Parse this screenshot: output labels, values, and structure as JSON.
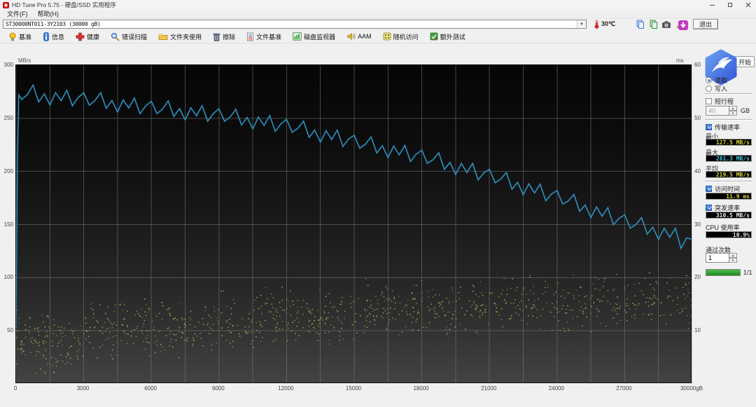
{
  "window": {
    "title": "HD Tune Pro 5.75 - 硬盘/SSD 实用程序"
  },
  "menu_bar": {
    "items": [
      "文件(F)",
      "帮助(H)"
    ]
  },
  "drive_bar": {
    "drive": "ST30000NT011-3Y2103 (30000 gB)",
    "temperature": "30℃",
    "exit": "退出"
  },
  "toolbar": {
    "items": [
      "基准",
      "信息",
      "健康",
      "错误扫描",
      "文件夹使用",
      "擦除",
      "文件基准",
      "磁盘监视器",
      "AAM",
      "随机访问",
      "额外测试"
    ]
  },
  "chart_data": {
    "type": "line+scatter",
    "x_axis": {
      "min": 0,
      "max": 30000,
      "grid_interval": 1500,
      "tick_labels": [
        "0",
        "3000",
        "6000",
        "9000",
        "12000",
        "15000",
        "18000",
        "21000",
        "24000",
        "27000",
        "30000gB"
      ],
      "tick_values": [
        0,
        3000,
        6000,
        9000,
        12000,
        15000,
        18000,
        21000,
        24000,
        27000,
        30000
      ]
    },
    "y_left": {
      "label": "MB/s",
      "min": 0,
      "max": 300,
      "tick_interval": 50,
      "tick_labels": [
        "300",
        "250",
        "200",
        "150",
        "100",
        "50"
      ],
      "tick_values": [
        300,
        250,
        200,
        150,
        100,
        50
      ]
    },
    "y_right": {
      "label": "ms",
      "min": 0,
      "max": 60,
      "tick_interval": 10,
      "tick_labels": [
        "60",
        "50",
        "40",
        "30",
        "20",
        "10"
      ],
      "tick_values": [
        60,
        50,
        40,
        30,
        20,
        10
      ]
    },
    "grid_color": "#7a7a7a",
    "series": [
      {
        "name": "transfer-rate",
        "type": "line",
        "axis": "left",
        "color": "#3a9fd2",
        "points": [
          [
            0,
            52
          ],
          [
            60,
            215
          ],
          [
            120,
            272
          ],
          [
            250,
            267.6
          ],
          [
            500,
            272.2
          ],
          [
            750,
            281.3
          ],
          [
            1000,
            265.3
          ],
          [
            1250,
            272.9
          ],
          [
            1500,
            262.5
          ],
          [
            1750,
            274.1
          ],
          [
            2000,
            266.7
          ],
          [
            2250,
            276.3
          ],
          [
            2500,
            261.8
          ],
          [
            2750,
            269.4
          ],
          [
            3000,
            274.0
          ],
          [
            3250,
            262.3
          ],
          [
            3500,
            266.7
          ],
          [
            3750,
            274.0
          ],
          [
            4000,
            259.3
          ],
          [
            4250,
            266.7
          ],
          [
            4500,
            256.0
          ],
          [
            4750,
            267.3
          ],
          [
            5000,
            259.7
          ],
          [
            5250,
            269.0
          ],
          [
            5500,
            254.3
          ],
          [
            5750,
            261.7
          ],
          [
            6000,
            266.0
          ],
          [
            6250,
            254.4
          ],
          [
            6500,
            258.8
          ],
          [
            6750,
            266.3
          ],
          [
            7000,
            251.7
          ],
          [
            7250,
            259.1
          ],
          [
            7500,
            248.5
          ],
          [
            7750,
            259.9
          ],
          [
            8000,
            252.3
          ],
          [
            8250,
            261.8
          ],
          [
            8500,
            247.2
          ],
          [
            8750,
            254.6
          ],
          [
            9000,
            259.0
          ],
          [
            9250,
            247.2
          ],
          [
            9500,
            251.3
          ],
          [
            9750,
            258.5
          ],
          [
            10000,
            243.7
          ],
          [
            10250,
            250.8
          ],
          [
            10500,
            240.0
          ],
          [
            10750,
            251.2
          ],
          [
            11000,
            243.3
          ],
          [
            11250,
            252.5
          ],
          [
            11500,
            237.7
          ],
          [
            11750,
            244.8
          ],
          [
            12000,
            249.0
          ],
          [
            12250,
            236.8
          ],
          [
            12500,
            240.5
          ],
          [
            12750,
            247.3
          ],
          [
            13000,
            232.0
          ],
          [
            13250,
            238.8
          ],
          [
            13500,
            227.5
          ],
          [
            13750,
            238.3
          ],
          [
            14000,
            230.0
          ],
          [
            14250,
            238.8
          ],
          [
            14500,
            223.5
          ],
          [
            14750,
            230.3
          ],
          [
            15000,
            234.0
          ],
          [
            15250,
            221.8
          ],
          [
            15500,
            225.7
          ],
          [
            15750,
            232.5
          ],
          [
            16000,
            217.3
          ],
          [
            16250,
            224.2
          ],
          [
            16500,
            213.0
          ],
          [
            16750,
            223.8
          ],
          [
            17000,
            215.7
          ],
          [
            17250,
            224.5
          ],
          [
            17500,
            209.3
          ],
          [
            17750,
            216.2
          ],
          [
            18000,
            220.0
          ],
          [
            18250,
            207.5
          ],
          [
            18500,
            211.0
          ],
          [
            18750,
            217.5
          ],
          [
            19000,
            202.0
          ],
          [
            19250,
            208.5
          ],
          [
            19500,
            197.0
          ],
          [
            19750,
            207.5
          ],
          [
            20000,
            199.0
          ],
          [
            20250,
            207.5
          ],
          [
            20500,
            192.0
          ],
          [
            20750,
            198.5
          ],
          [
            21000,
            202.0
          ],
          [
            21250,
            189.3
          ],
          [
            21500,
            192.7
          ],
          [
            21750,
            199.0
          ],
          [
            22000,
            183.3
          ],
          [
            22250,
            189.7
          ],
          [
            22500,
            178.0
          ],
          [
            22750,
            188.3
          ],
          [
            23000,
            179.7
          ],
          [
            23250,
            188.0
          ],
          [
            23500,
            172.3
          ],
          [
            23750,
            178.7
          ],
          [
            24000,
            182.0
          ],
          [
            24250,
            169.1
          ],
          [
            24500,
            172.2
          ],
          [
            24750,
            178.3
          ],
          [
            25000,
            162.3
          ],
          [
            25250,
            168.4
          ],
          [
            25500,
            156.5
          ],
          [
            25750,
            166.6
          ],
          [
            26000,
            157.7
          ],
          [
            26250,
            165.8
          ],
          [
            26500,
            149.8
          ],
          [
            26750,
            155.9
          ],
          [
            27000,
            159.0
          ],
          [
            27250,
            146.5
          ],
          [
            27500,
            150.0
          ],
          [
            27750,
            156.5
          ],
          [
            28000,
            141.0
          ],
          [
            28250,
            147.5
          ],
          [
            28500,
            136.0
          ],
          [
            28750,
            146.5
          ],
          [
            29000,
            138.0
          ],
          [
            29250,
            146.5
          ],
          [
            29500,
            127.5
          ],
          [
            29750,
            137.5
          ],
          [
            30000,
            136.0
          ]
        ]
      },
      {
        "name": "access-time",
        "type": "scatter",
        "axis": "right",
        "color": "#b7ae55",
        "seed": 20240613,
        "stats": {
          "avg_ms": 11.9
        },
        "bands": [
          {
            "gb": [
              0,
              3000
            ],
            "ms": [
              1.5,
              14.5
            ],
            "count": 130
          },
          {
            "gb": [
              3000,
              9000
            ],
            "ms": [
              4,
              16.5
            ],
            "count": 210
          },
          {
            "gb": [
              9000,
              15000
            ],
            "ms": [
              6.5,
              18.5
            ],
            "count": 210
          },
          {
            "gb": [
              15000,
              21000
            ],
            "ms": [
              8.5,
              20
            ],
            "count": 210
          },
          {
            "gb": [
              21000,
              30000
            ],
            "ms": [
              9.5,
              21
            ],
            "count": 270
          }
        ]
      }
    ]
  },
  "panel": {
    "start": "开始",
    "mode": {
      "read": "读取",
      "write": "写入",
      "selected": "read"
    },
    "short_stroke": {
      "label": "短行程",
      "checked": false,
      "value": "40",
      "unit": "GB"
    },
    "transfer": {
      "label": "传输速率",
      "checked": true,
      "min_label": "最小",
      "min": "127.5 MB/s",
      "max_label": "最大",
      "max": "281.3 MB/s",
      "avg_label": "平均",
      "avg": "219.5 MB/s"
    },
    "access": {
      "label": "访问时间",
      "checked": true,
      "value": "11.9 ms"
    },
    "burst": {
      "label": "突发速率",
      "checked": true,
      "value": "310.5 MB/s"
    },
    "cpu": {
      "label": "CPU 使用率",
      "value": "10.9%"
    },
    "passes": {
      "label": "通过次数",
      "value": "1",
      "progress": 1.0,
      "progress_label": "1/1"
    },
    "lcd_colors": {
      "min": "#d6d63a",
      "max": "#46c8dc",
      "avg": "#d6d63a",
      "access": "#d6d63a",
      "burst": "#e8e8e8",
      "cpu": "#e8e8e8"
    }
  }
}
